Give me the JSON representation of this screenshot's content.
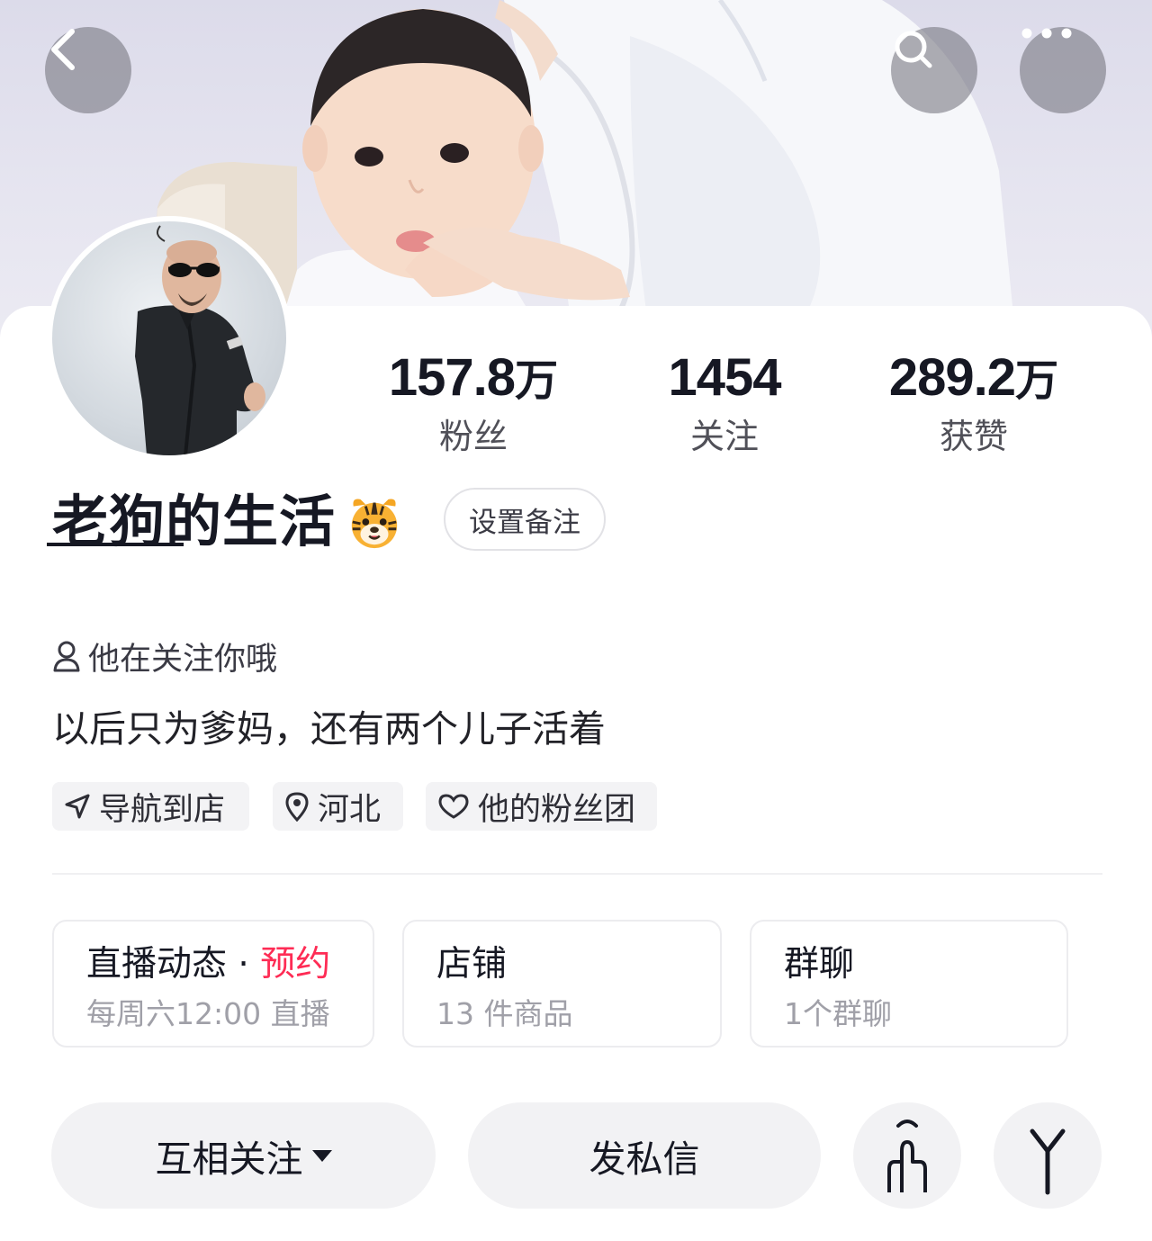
{
  "header": {
    "back_icon": "chevron-left-icon",
    "search_icon": "search-icon",
    "more_icon": "more-horizontal-icon"
  },
  "profile": {
    "name": "老狗的生活",
    "name_emoji": "tiger-face-emoji",
    "remark_button": "设置备注",
    "stats": [
      {
        "value": "157.8",
        "unit": "万",
        "label": "粉丝"
      },
      {
        "value": "1454",
        "unit": "",
        "label": "关注"
      },
      {
        "value": "289.2",
        "unit": "万",
        "label": "获赞"
      }
    ],
    "follow_hint": "他在关注你哦",
    "bio": "以后只为爹妈，还有两个儿子活着",
    "tags": [
      {
        "icon": "navigation-arrow-icon",
        "label": "导航到店"
      },
      {
        "icon": "location-pin-icon",
        "label": "河北"
      },
      {
        "icon": "heart-icon",
        "label": "他的粉丝团"
      }
    ]
  },
  "features": {
    "live": {
      "title": "直播动态",
      "separator": " · ",
      "accent": "预约",
      "sub": "每周六12:00 直播"
    },
    "shop": {
      "title": "店铺",
      "sub": "13 件商品"
    },
    "group": {
      "title": "群聊",
      "sub": "1个群聊"
    }
  },
  "actions": {
    "follow_label": "互相关注",
    "message_label": "发私信",
    "icon1": "share-hand-icon",
    "icon2": "expand-icon"
  },
  "colors": {
    "accent": "#fe2c55",
    "text_primary": "#161823",
    "text_secondary": "#a0a0a8",
    "button_bg": "#f2f2f4"
  }
}
